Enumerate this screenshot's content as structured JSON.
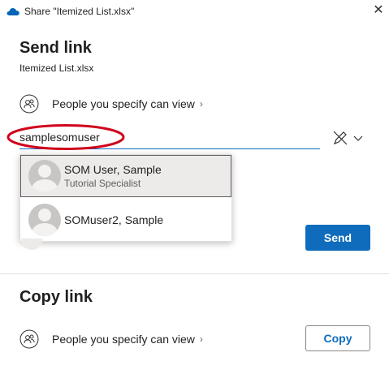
{
  "titlebar": {
    "title": "Share \"Itemized List.xlsx\"",
    "app_icon": "onedrive-cloud-icon",
    "close_icon": "close-icon",
    "close_glyph": "✕"
  },
  "send_link": {
    "heading": "Send link",
    "file_name": "Itemized List.xlsx",
    "permission_label": "People you specify can view",
    "permission_chevron": "›",
    "to_value": "samplesomuser",
    "pen_icon": "pen-slash-icon",
    "send_label": "Send"
  },
  "suggestions": [
    {
      "name": "SOM User, Sample",
      "role": "Tutorial Specialist",
      "selected": true
    },
    {
      "name": "SOMuser2, Sample",
      "role": "",
      "selected": false
    }
  ],
  "copy_link": {
    "heading": "Copy link",
    "permission_label": "People you specify can view",
    "permission_chevron": "›",
    "copy_label": "Copy"
  },
  "colors": {
    "accent": "#0f6cbd",
    "highlight_ellipse": "#d0021b"
  }
}
